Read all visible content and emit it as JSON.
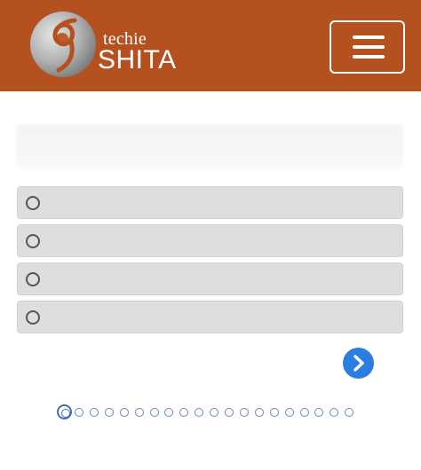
{
  "header": {
    "logo_top": "techie",
    "logo_bottom": "SHITA",
    "menu_icon": "hamburger-menu-icon",
    "background": "#b5511f"
  },
  "quiz": {
    "question_text": "",
    "options": [
      {
        "label": ""
      },
      {
        "label": ""
      },
      {
        "label": ""
      },
      {
        "label": ""
      }
    ],
    "next_icon": "chevron-right-icon",
    "next_color": "#2b7ee0"
  },
  "pagination": {
    "total": 20,
    "current": 1
  }
}
